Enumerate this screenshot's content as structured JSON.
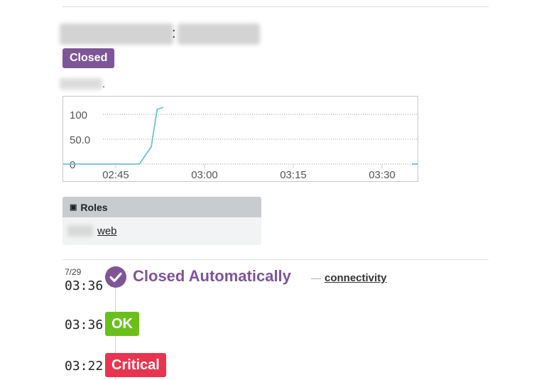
{
  "monitor": {
    "status": "Closed"
  },
  "chart_data": {
    "type": "line",
    "x_ticks": [
      "02:45",
      "03:00",
      "03:15",
      "03:30"
    ],
    "y_ticks": [
      "0",
      "50.0",
      "100"
    ],
    "ylim": [
      0,
      120
    ],
    "grid": "horizontal dotted",
    "color": "#6cc1cf",
    "series": [
      {
        "values": [
          [
            "02:34",
            0
          ],
          [
            "02:40",
            0
          ],
          [
            "02:46",
            0
          ],
          [
            "02:49",
            0
          ],
          [
            "02:51",
            35
          ],
          [
            "02:52",
            110
          ],
          [
            "02:53",
            114
          ]
        ]
      }
    ],
    "tail_segment": [
      [
        "03:35",
        0
      ],
      [
        "03:36",
        0
      ]
    ]
  },
  "roles": {
    "header": "Roles",
    "icon": "window-icon",
    "link": "web"
  },
  "timeline": {
    "date": "7/29",
    "events": [
      {
        "time": "03:36",
        "title": "Closed Automatically",
        "separator": "—",
        "link": "connectivity",
        "icon": "check-circle-icon"
      },
      {
        "time": "03:36",
        "badge": "OK"
      },
      {
        "time": "03:22",
        "badge": "Critical"
      }
    ]
  },
  "colors": {
    "closed": "#7e5597",
    "ok": "#6bbf1d",
    "critical": "#e8344f",
    "series": "#6cc1cf"
  }
}
